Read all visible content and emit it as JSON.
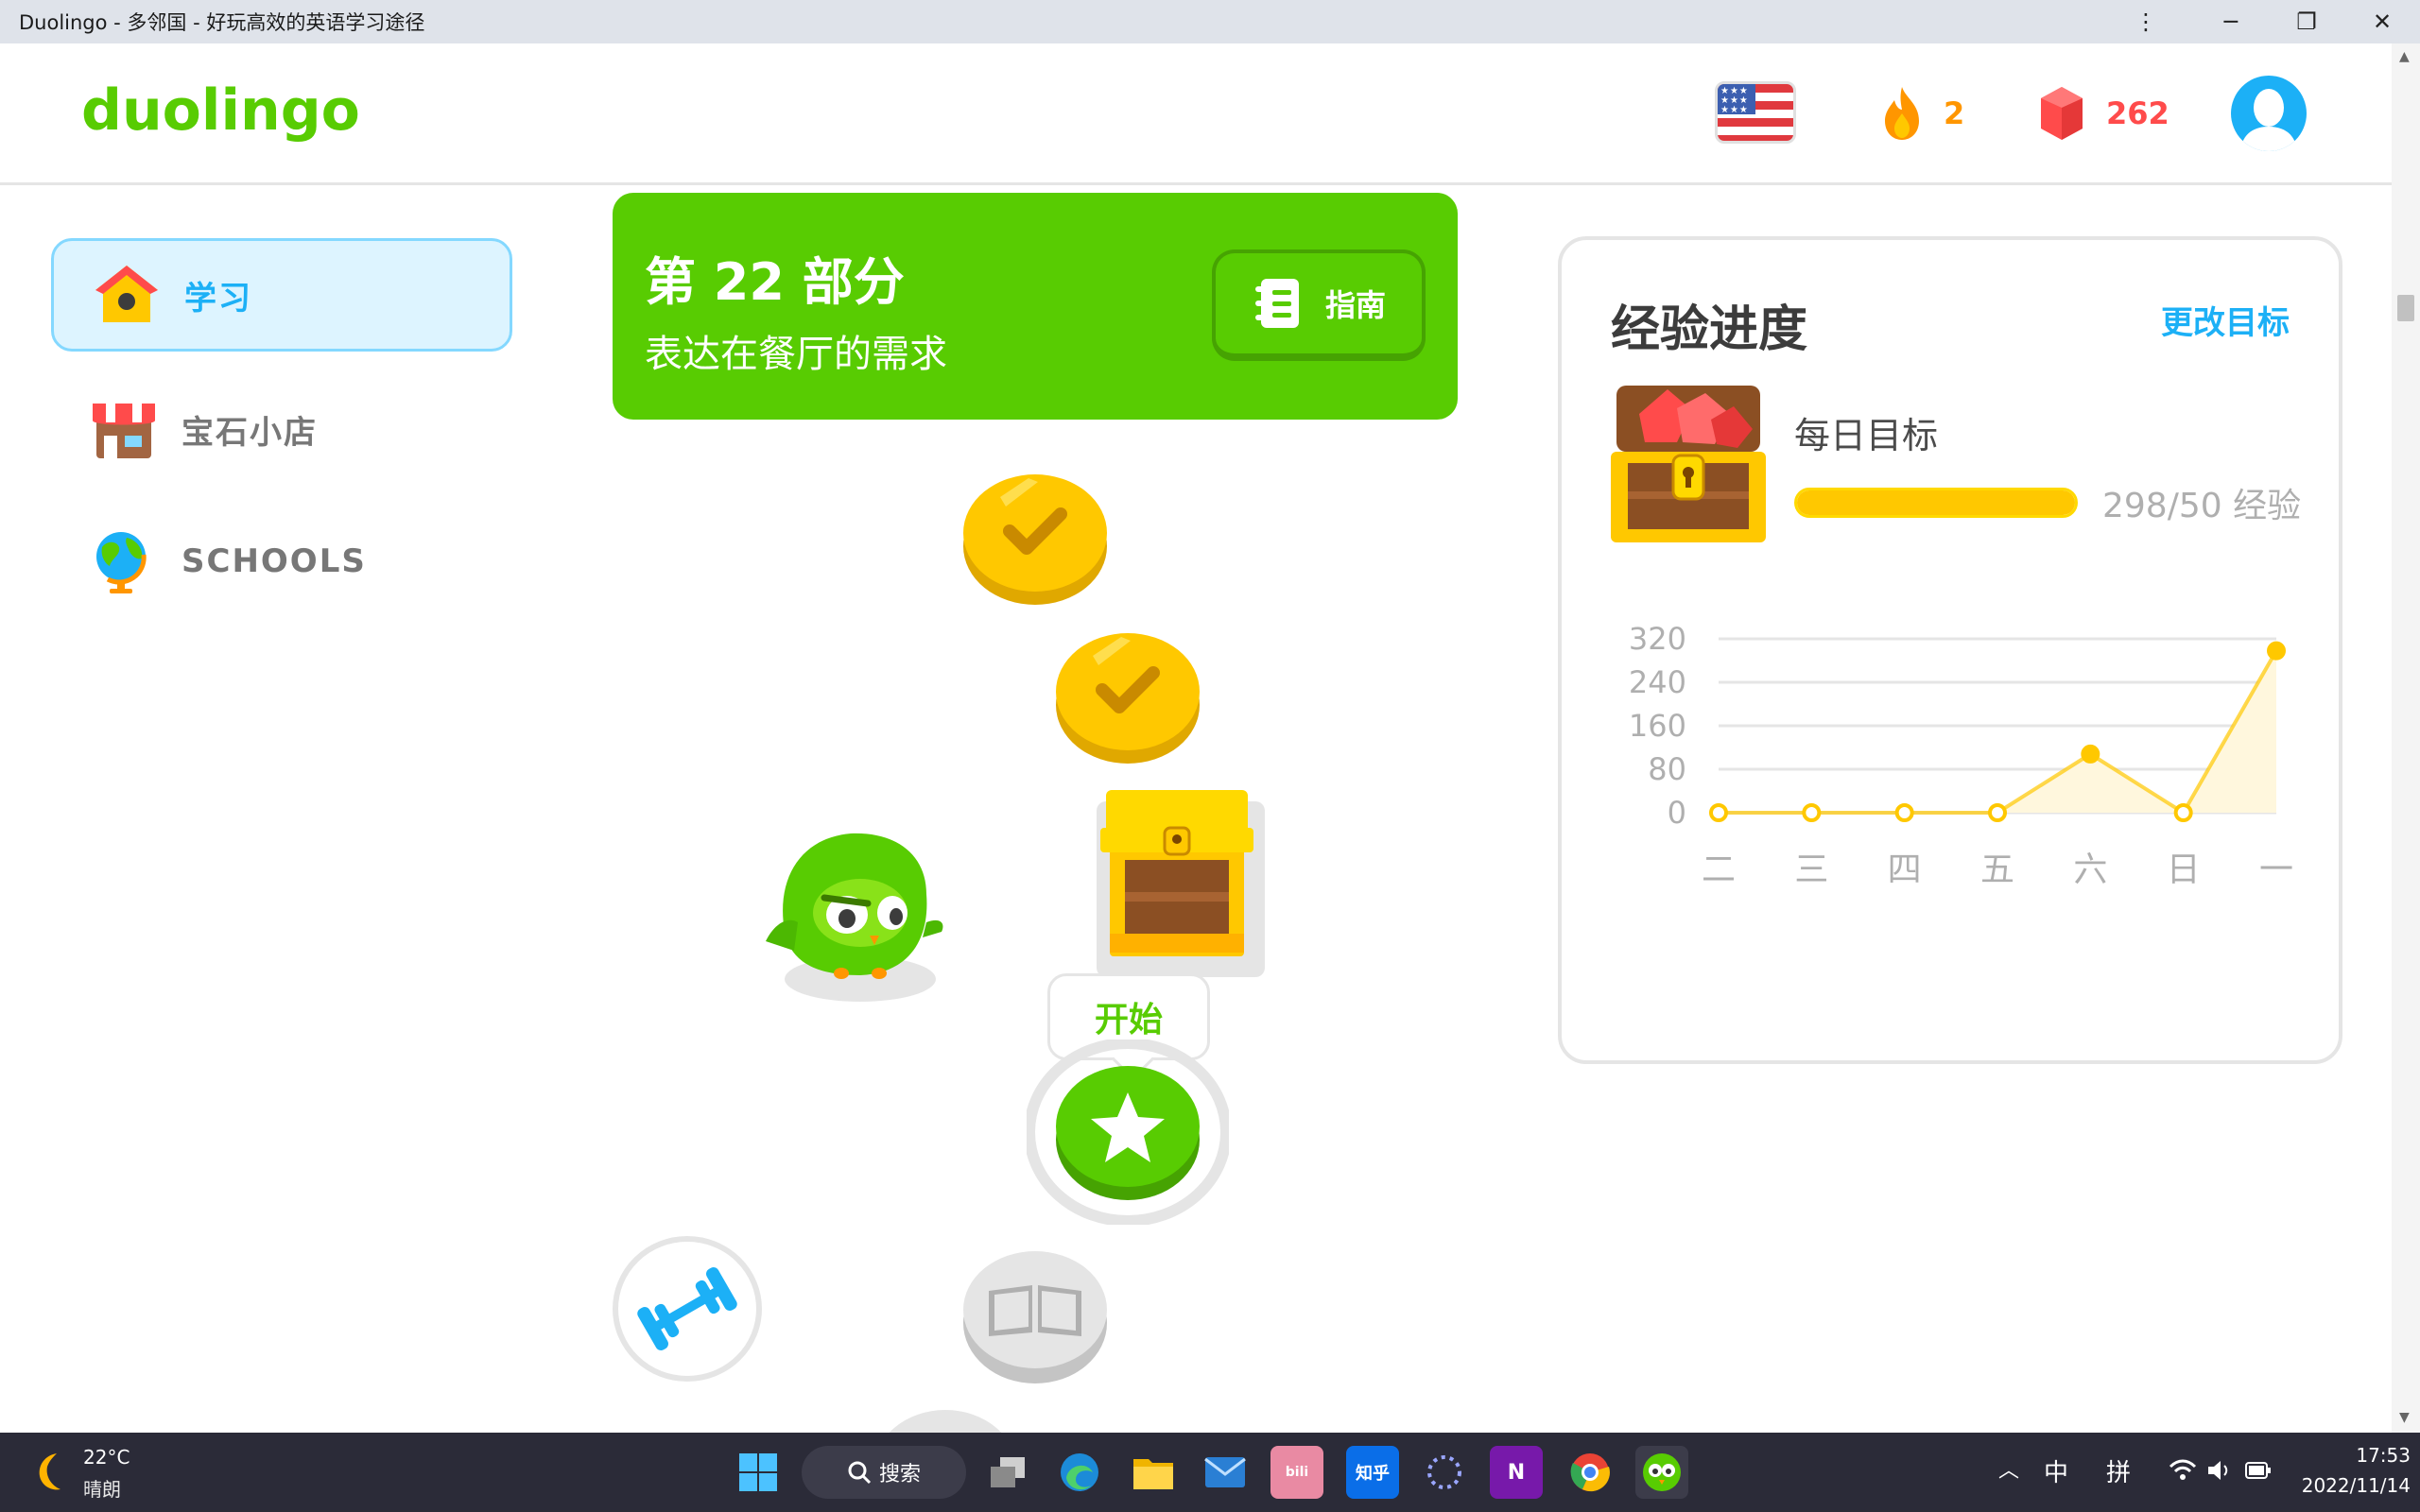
{
  "window": {
    "title": "Duolingo - 多邻国 - 好玩高效的英语学习途径",
    "controls": {
      "more": "⋮",
      "minimize": "─",
      "restore": "❐",
      "close": "✕"
    }
  },
  "header": {
    "logo": "duolingo",
    "course_flag_icon": "us-flag-icon",
    "streak": "2",
    "gems": "262",
    "avatar_icon": "avatar-icon"
  },
  "sidebar": {
    "items": [
      {
        "label": "学习",
        "icon": "home-icon",
        "active": true
      },
      {
        "label": "宝石小店",
        "icon": "shop-icon",
        "active": false
      },
      {
        "label": "SCHOOLS",
        "icon": "globe-icon",
        "active": false
      }
    ]
  },
  "unit": {
    "title": "第 22 部分",
    "subtitle": "表达在餐厅的需求",
    "guide_label": "指南"
  },
  "path": {
    "start_label": "开始",
    "nodes": [
      "completed-lesson",
      "completed-lesson",
      "treasure-chest",
      "current-lesson-star",
      "practice-dumbbell",
      "story-book"
    ]
  },
  "xp_panel": {
    "title": "经验进度",
    "change_goal": "更改目标",
    "daily_goal_label": "每日目标",
    "daily_goal_progress": "298/50 经验",
    "daily_goal_fraction": 1.0
  },
  "chart_data": {
    "type": "area",
    "categories": [
      "二",
      "三",
      "四",
      "五",
      "六",
      "日",
      "一"
    ],
    "values": [
      0,
      0,
      0,
      0,
      108,
      0,
      298
    ],
    "yticks": [
      "320",
      "240",
      "160",
      "80",
      "0"
    ],
    "ylim": [
      0,
      320
    ],
    "grid": true,
    "color": "#ffc800"
  },
  "taskbar": {
    "temperature": "22°C",
    "weather": "晴朗",
    "search_label": "搜索",
    "zhihu_label": "知乎",
    "onenote_label": "N",
    "ime_lang": "中",
    "ime_mode": "拼",
    "time": "17:53",
    "date": "2022/11/14",
    "colors": {
      "background": "#2b2b38"
    }
  },
  "colors": {
    "green": "#58cc02",
    "blue": "#1cb0f6",
    "gold": "#ffc800",
    "orange": "#ff9600",
    "red": "#ff4b4b"
  }
}
